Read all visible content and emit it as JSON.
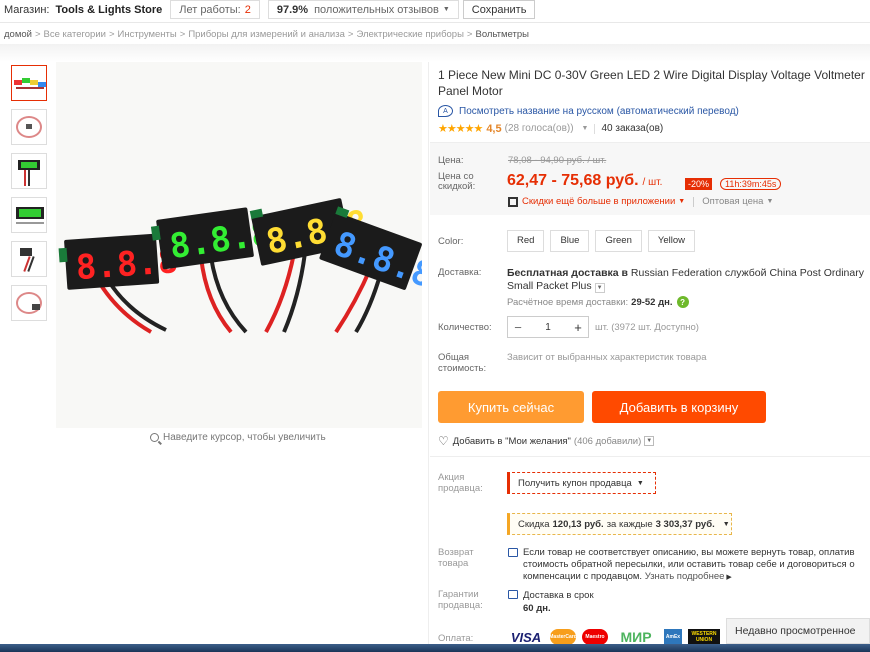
{
  "store_bar": {
    "label": "Магазин:",
    "store_name": "Tools & Lights Store",
    "years_label": "Лет работы:",
    "years_value": "2",
    "feedback_pct": "97.9%",
    "feedback_label": "положительных отзывов",
    "save_label": "Сохранить"
  },
  "breadcrumbs": [
    "домой",
    "Все категории",
    "Инструменты",
    "Приборы для измерений и анализа",
    "Электрические приборы",
    "Вольтметры"
  ],
  "gallery": {
    "zoom_hint": "Наведите курсор, чтобы увеличить",
    "thumb_count": 6
  },
  "product": {
    "title": "1 Piece New Mini DC 0-30V Green LED 2 Wire Digital Display Voltage Voltmeter Panel Motor",
    "translate_link": "Посмотреть название на русском (автоматический перевод)",
    "rating_score": "4,5",
    "rating_votes": "(28 голоса(ов))",
    "orders": "40 заказа(ов)"
  },
  "pricing": {
    "price_label": "Цена:",
    "old_price": "78,08 - 94,90 руб. / шт.",
    "discount_price_label_1": "Цена со",
    "discount_price_label_2": "скидкой:",
    "new_price": "62,47 - 75,68 руб.",
    "unit": "/ шт.",
    "discount_badge": "-20%",
    "timer": "11h:39m:45s",
    "app_deal": "Скидки ещё больше в приложении",
    "wholesale": "Оптовая цена"
  },
  "sku": {
    "color_label": "Color:",
    "colors": [
      "Red",
      "Blue",
      "Green",
      "Yellow"
    ],
    "shipping_label": "Доставка:",
    "shipping_pre": "Бесплатная доставка в",
    "shipping_country": "Russian Federation",
    "shipping_mid": "службой",
    "shipping_service": "China Post Ordinary Small Packet Plus",
    "est_label": "Расчётное время доставки:",
    "est_value": "29-52 дн.",
    "qty_label": "Количество:",
    "qty_value": "1",
    "stock": "шт. (3972 шт. Доступно)",
    "total_label_1": "Общая",
    "total_label_2": "стоимость:",
    "total_value": "Зависит от выбранных характеристик товара"
  },
  "actions": {
    "buy_now": "Купить сейчас",
    "add_to_cart": "Добавить в корзину",
    "wishlist": "Добавить в \"Мои желания\"",
    "wishlist_count": "(406 добавили)"
  },
  "promo": {
    "seller_promo_label_1": "Акция",
    "seller_promo_label_2": "продавца:",
    "coupon": "Получить купон продавца",
    "discount_pre": "Скидка",
    "discount_amount": "120,13 руб.",
    "discount_mid": "за каждые",
    "discount_threshold": "3 303,37 руб."
  },
  "service": {
    "returns_label_1": "Возврат",
    "returns_label_2": "товара",
    "returns_text": "Если товар не соответствует описанию, вы можете вернуть товар, оплатив стоимость обратной пересылки, или оставить товар себе и договориться о компенсации с продавцом.",
    "returns_more": "Узнать подробнее",
    "guarantee_label_1": "Гарантии",
    "guarantee_label_2": "продавца:",
    "guarantee_text": "Доставка в срок",
    "guarantee_days": "60 дн.",
    "payment_label": "Оплата:",
    "payment_logos": [
      "VISA",
      "MasterCard",
      "Maestro",
      "МИР",
      "AmEx",
      "WESTERN UNION"
    ]
  },
  "recent": {
    "label": "Недавно просмотренное"
  },
  "colors": {
    "accent": "#e62e04",
    "buy": "#ff9b31",
    "cart": "#ff4a00",
    "link": "#2a57a5"
  }
}
